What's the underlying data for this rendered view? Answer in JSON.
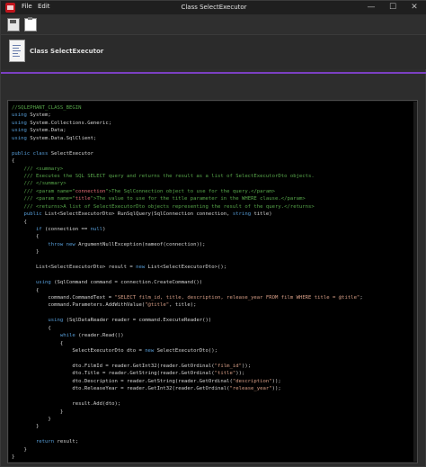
{
  "window": {
    "title": "Class SelectExecutor",
    "menu": [
      "File",
      "Edit"
    ],
    "controls": [
      "—",
      "☐",
      "✕"
    ]
  },
  "toolbar": {
    "items": [
      "save-icon",
      "paste-icon"
    ]
  },
  "header": {
    "title": "Class SelectExecutor"
  },
  "colors": {
    "accent": "#7b3fc2",
    "editor_bg": "#000000",
    "comment": "#57a64a",
    "keyword": "#569cd6",
    "string": "#d69d85",
    "app_icon": "#c0141c"
  },
  "code_lines": [
    [
      {
        "t": "//SQLEPHANT_CLASS_BEGIN",
        "c": "comment"
      }
    ],
    [
      {
        "t": "using",
        "c": "kw"
      },
      {
        "t": " System;",
        "c": "plain"
      }
    ],
    [
      {
        "t": "using",
        "c": "kw"
      },
      {
        "t": " System.Collections.Generic;",
        "c": "plain"
      }
    ],
    [
      {
        "t": "using",
        "c": "kw"
      },
      {
        "t": " System.Data;",
        "c": "plain"
      }
    ],
    [
      {
        "t": "using",
        "c": "kw"
      },
      {
        "t": " System.Data.SqlClient;",
        "c": "plain"
      }
    ],
    [
      {
        "t": "",
        "c": "plain"
      }
    ],
    [
      {
        "t": "public class",
        "c": "kw"
      },
      {
        "t": " SelectExecutor",
        "c": "plain"
      }
    ],
    [
      {
        "t": "{",
        "c": "plain"
      }
    ],
    [
      {
        "t": "    /// ",
        "c": "comment"
      },
      {
        "t": "<summary>",
        "c": "comment"
      }
    ],
    [
      {
        "t": "    /// Executes the SQL SELECT query and returns the result as a list of SelectExecutorDto objects.",
        "c": "comment"
      }
    ],
    [
      {
        "t": "    /// ",
        "c": "comment"
      },
      {
        "t": "</summary>",
        "c": "comment"
      }
    ],
    [
      {
        "t": "    /// ",
        "c": "comment"
      },
      {
        "t": "<param name=\"",
        "c": "comment"
      },
      {
        "t": "connection",
        "c": "red"
      },
      {
        "t": "\">The SqlConnection object to use for the query.</param>",
        "c": "comment"
      }
    ],
    [
      {
        "t": "    /// ",
        "c": "comment"
      },
      {
        "t": "<param name=\"",
        "c": "comment"
      },
      {
        "t": "title",
        "c": "red"
      },
      {
        "t": "\">The value to use for the title parameter in the WHERE clause.</param>",
        "c": "comment"
      }
    ],
    [
      {
        "t": "    /// <returns>A list of SelectExecutorDto objects representing the result of the query.</returns>",
        "c": "comment"
      }
    ],
    [
      {
        "t": "    public",
        "c": "kw"
      },
      {
        "t": " List<SelectExecutorDto> RunSqlQuery(SqlConnection connection, ",
        "c": "plain"
      },
      {
        "t": "string",
        "c": "kw"
      },
      {
        "t": " title)",
        "c": "plain"
      }
    ],
    [
      {
        "t": "    {",
        "c": "plain"
      }
    ],
    [
      {
        "t": "        if",
        "c": "kw"
      },
      {
        "t": " (connection == ",
        "c": "plain"
      },
      {
        "t": "null",
        "c": "kw"
      },
      {
        "t": ")",
        "c": "plain"
      }
    ],
    [
      {
        "t": "        {",
        "c": "plain"
      }
    ],
    [
      {
        "t": "            throw new",
        "c": "kw"
      },
      {
        "t": " ArgumentNullException(nameof(connection));",
        "c": "plain"
      }
    ],
    [
      {
        "t": "        }",
        "c": "plain"
      }
    ],
    [
      {
        "t": "",
        "c": "plain"
      }
    ],
    [
      {
        "t": "        List<SelectExecutorDto> result = ",
        "c": "plain"
      },
      {
        "t": "new",
        "c": "kw"
      },
      {
        "t": " List<SelectExecutorDto>();",
        "c": "plain"
      }
    ],
    [
      {
        "t": "",
        "c": "plain"
      }
    ],
    [
      {
        "t": "        using",
        "c": "kw"
      },
      {
        "t": " (SqlCommand command = connection.CreateCommand())",
        "c": "plain"
      }
    ],
    [
      {
        "t": "        {",
        "c": "plain"
      }
    ],
    [
      {
        "t": "            command.CommandText = ",
        "c": "plain"
      },
      {
        "t": "\"SELECT film_id, title, description, release_year FROM film WHERE title = @title\"",
        "c": "str"
      },
      {
        "t": ";",
        "c": "plain"
      }
    ],
    [
      {
        "t": "            command.Parameters.AddWithValue(",
        "c": "plain"
      },
      {
        "t": "\"@title\"",
        "c": "str"
      },
      {
        "t": ", title);",
        "c": "plain"
      }
    ],
    [
      {
        "t": "",
        "c": "plain"
      }
    ],
    [
      {
        "t": "            using",
        "c": "kw"
      },
      {
        "t": " (SqlDataReader reader = command.ExecuteReader())",
        "c": "plain"
      }
    ],
    [
      {
        "t": "            {",
        "c": "plain"
      }
    ],
    [
      {
        "t": "                while",
        "c": "kw"
      },
      {
        "t": " (reader.Read())",
        "c": "plain"
      }
    ],
    [
      {
        "t": "                {",
        "c": "plain"
      }
    ],
    [
      {
        "t": "                    SelectExecutorDto dto = ",
        "c": "plain"
      },
      {
        "t": "new",
        "c": "kw"
      },
      {
        "t": " SelectExecutorDto();",
        "c": "plain"
      }
    ],
    [
      {
        "t": "",
        "c": "plain"
      }
    ],
    [
      {
        "t": "                    dto.FilmId = reader.GetInt32(reader.GetOrdinal(",
        "c": "plain"
      },
      {
        "t": "\"film_id\"",
        "c": "str"
      },
      {
        "t": "));",
        "c": "plain"
      }
    ],
    [
      {
        "t": "                    dto.Title = reader.GetString(reader.GetOrdinal(",
        "c": "plain"
      },
      {
        "t": "\"title\"",
        "c": "str"
      },
      {
        "t": "));",
        "c": "plain"
      }
    ],
    [
      {
        "t": "                    dto.Description = reader.GetString(reader.GetOrdinal(",
        "c": "plain"
      },
      {
        "t": "\"description\"",
        "c": "str"
      },
      {
        "t": "));",
        "c": "plain"
      }
    ],
    [
      {
        "t": "                    dto.ReleaseYear = reader.GetInt32(reader.GetOrdinal(",
        "c": "plain"
      },
      {
        "t": "\"release_year\"",
        "c": "str"
      },
      {
        "t": "));",
        "c": "plain"
      }
    ],
    [
      {
        "t": "",
        "c": "plain"
      }
    ],
    [
      {
        "t": "                    result.Add(dto);",
        "c": "plain"
      }
    ],
    [
      {
        "t": "                }",
        "c": "plain"
      }
    ],
    [
      {
        "t": "            }",
        "c": "plain"
      }
    ],
    [
      {
        "t": "        }",
        "c": "plain"
      }
    ],
    [
      {
        "t": "",
        "c": "plain"
      }
    ],
    [
      {
        "t": "        return",
        "c": "kw"
      },
      {
        "t": " result;",
        "c": "plain"
      }
    ],
    [
      {
        "t": "    }",
        "c": "plain"
      }
    ],
    [
      {
        "t": "}",
        "c": "plain"
      }
    ],
    [
      {
        "t": "//SQLEPHANT_CLASS_END",
        "c": "comment"
      }
    ]
  ]
}
